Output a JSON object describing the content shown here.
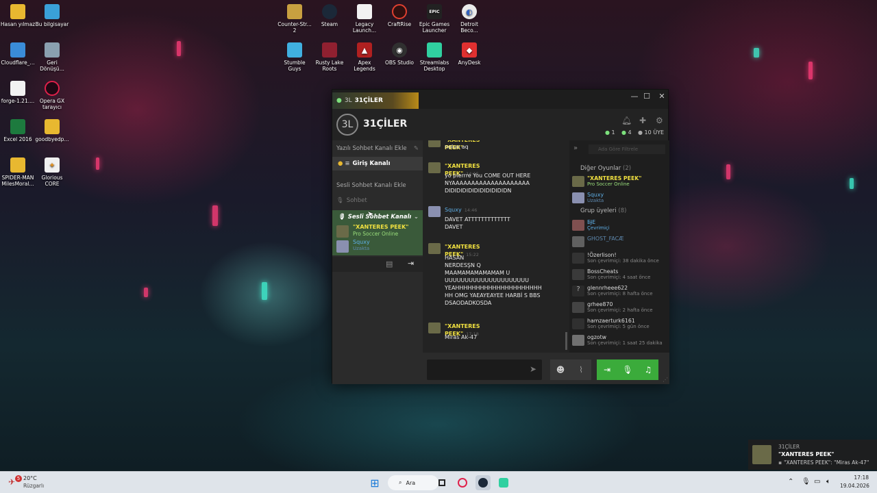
{
  "desktop": {
    "icons_left": [
      {
        "label": "Hasan yılmaz",
        "icon": "folder-icon"
      },
      {
        "label": "Bu bilgisayar",
        "icon": "computer-icon"
      },
      {
        "label": "Cloudflare_...",
        "icon": "installer-icon"
      },
      {
        "label": "Geri Dönüşü...",
        "icon": "recycle-bin-icon"
      },
      {
        "label": "forge-1.21....",
        "icon": "file-icon"
      },
      {
        "label": "Opera GX tarayıcı",
        "icon": "opera-gx-icon"
      },
      {
        "label": "Excel 2016",
        "icon": "excel-icon"
      },
      {
        "label": "goodbyedp...",
        "icon": "folder-icon"
      },
      {
        "label": "SPIDER-MAN MilesMoral...",
        "icon": "folder-icon"
      },
      {
        "label": "Glorious CORE",
        "icon": "glorious-icon"
      }
    ],
    "icons_top": [
      {
        "label": "Counter-Str... 2",
        "icon": "counter-strike-icon"
      },
      {
        "label": "Steam",
        "icon": "steam-icon"
      },
      {
        "label": "Legacy Launch...",
        "icon": "file-icon"
      },
      {
        "label": "CraftRise",
        "icon": "craftrise-icon"
      },
      {
        "label": "Epic Games Launcher",
        "icon": "epic-games-icon",
        "glyph": "EPIC"
      },
      {
        "label": "Detroit Beco...",
        "icon": "detroit-icon"
      },
      {
        "label": "Stumble Guys",
        "icon": "stumble-guys-icon"
      },
      {
        "label": "Rusty Lake Roots",
        "icon": "rusty-lake-icon"
      },
      {
        "label": "Apex Legends",
        "icon": "apex-icon"
      },
      {
        "label": "OBS Studio",
        "icon": "obs-icon"
      },
      {
        "label": "Streamlabs Desktop",
        "icon": "streamlabs-icon"
      },
      {
        "label": "AnyDesk",
        "icon": "anydesk-icon"
      }
    ]
  },
  "window": {
    "tab_title": "31ÇİLER",
    "group_avatar": "3L",
    "group_name": "31ÇİLER",
    "stats": {
      "online": "1",
      "in_game": "4",
      "members": "10 ÜYE"
    }
  },
  "left_panel": {
    "text_section": "Yazılı Sohbet Kanalı Ekle",
    "text_channel": "Giriş Kanalı",
    "voice_section": "Sesli Sohbet Kanalı Ekle",
    "voice_placeholder": "Sohbet",
    "voice_channel": "Sesli Sohbet Kanalı",
    "voice_users": [
      {
        "name": "\"XANTERES PEEK\"",
        "status": "Pro Soccer Online"
      },
      {
        "name": "Squxy",
        "status": "Uzakta"
      }
    ]
  },
  "chat": {
    "messages": [
      {
        "author": "\"XANTERES PEEK\"",
        "time": "",
        "text": "noluo aq"
      },
      {
        "author": "\"XANTERES PEEK\"",
        "time": "14:15",
        "text": "yo pierrre You COME OUT HERE\nNYAAAAAAAAAAAAAAAAAAAA\nDIDIDIDIDIDIDIDIDIDIDN"
      },
      {
        "author": "Squxy",
        "time": "14:46",
        "text": "DAVET ATTTTTTTTTTTTT\nDAVET"
      },
      {
        "author": "\"XANTERES PEEK\"",
        "time": "15:22",
        "text": "HASAN\nNERDESŞN Q\nMAAMAMAMAMAMAM U\nUUUUUUUUUUUUUUUUUUUUU\nYEAHHHHHHHHHHHHHHHHHHHHH\nHH OMG YAEAYEAYEE HARBİ S BBS\nDSAODADKOSDA"
      },
      {
        "author": "\"XANTERES PEEK\"",
        "time": "17:18",
        "text": "Miras Ak-47"
      }
    ]
  },
  "members": {
    "search_placeholder": "Ada Göre Filtrele",
    "other_games_header": "Diğer Oyunlar",
    "other_games_count": "(2)",
    "other_games": [
      {
        "name": "\"XANTERES PEEK\"",
        "status": "Pro Soccer Online"
      },
      {
        "name": "Squxy",
        "status": "Uzakta"
      }
    ],
    "group_header": "Grup üyeleri",
    "group_count": "(8)",
    "group": [
      {
        "name": "EJ̶E",
        "status": "Çevrimiçi"
      },
      {
        "name": "GHOST_FACÆ",
        "status": ""
      },
      {
        "name": "!Özerlison!",
        "status": "Son çevrimiçi: 38 dakika önce"
      },
      {
        "name": "BossCheats",
        "status": "Son çevrimiçi: 4 saat önce"
      },
      {
        "name": "glennrheee622",
        "status": "Son çevrimiçi: 8 hafta önce"
      },
      {
        "name": "grhee870",
        "status": "Son çevrimiçi: 2 hafta önce"
      },
      {
        "name": "hamzaerturk6161",
        "status": "Son çevrimiçi: 5 gün önce"
      },
      {
        "name": "ogzotw",
        "status": "Son çevrimiçi: 1 saat 25 dakika"
      }
    ]
  },
  "notification": {
    "group": "31ÇİLER",
    "author": "\"XANTERES PEEK\"",
    "preview": "\"XANTERES PEEK\": \"Miras Ak-47\""
  },
  "taskbar": {
    "weather_temp": "20°C",
    "weather_desc": "Rüzgarlı",
    "weather_badge": "5",
    "search_label": "Ara",
    "time": "17:18",
    "date": "19.04.2026"
  }
}
